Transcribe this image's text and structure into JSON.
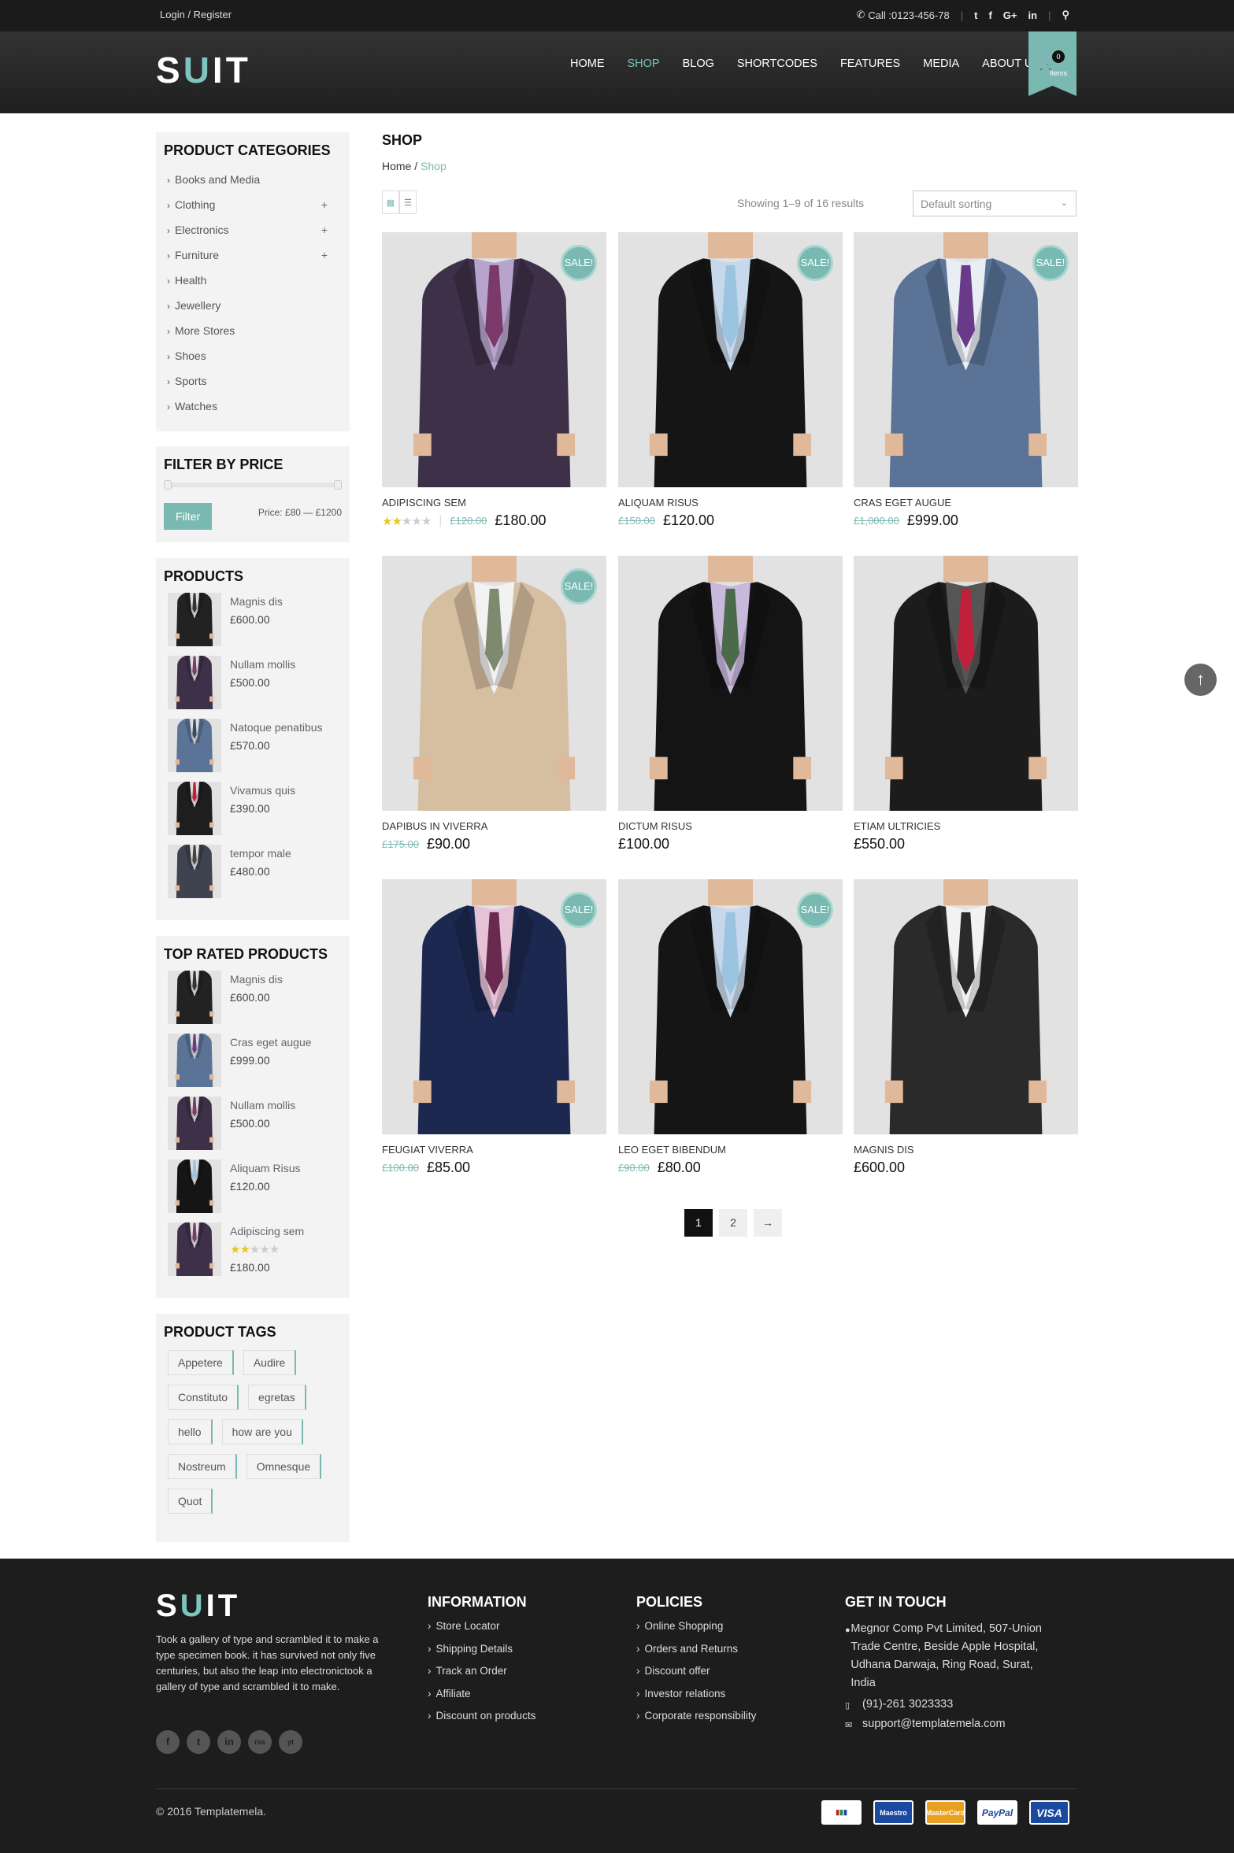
{
  "topbar": {
    "login": "Login / Register",
    "phone": "Call :0123-456-78",
    "social": [
      "twitter-icon",
      "facebook-icon",
      "google-plus-icon",
      "linkedin-icon"
    ],
    "social_labels": [
      "t",
      "f",
      "G+",
      "in"
    ]
  },
  "header": {
    "logo_s": "S",
    "logo_u": "U",
    "logo_it": "IT",
    "nav": [
      "HOME",
      "SHOP",
      "BLOG",
      "SHORTCODES",
      "FEATURES",
      "MEDIA",
      "ABOUT US"
    ],
    "active_nav": "SHOP",
    "cart_count": "0",
    "cart_label": "Items"
  },
  "categories": {
    "title": "PRODUCT CATEGORIES",
    "items": [
      {
        "label": "Books and Media",
        "expand": ""
      },
      {
        "label": "Clothing",
        "expand": "+"
      },
      {
        "label": "Electronics",
        "expand": "+"
      },
      {
        "label": "Furniture",
        "expand": "+"
      },
      {
        "label": "Health",
        "expand": ""
      },
      {
        "label": "Jewellery",
        "expand": ""
      },
      {
        "label": "More Stores",
        "expand": ""
      },
      {
        "label": "Shoes",
        "expand": ""
      },
      {
        "label": "Sports",
        "expand": ""
      },
      {
        "label": "Watches",
        "expand": ""
      }
    ]
  },
  "filter": {
    "title": "FILTER BY PRICE",
    "button": "Filter",
    "range_label": "Price: £80 — £1200"
  },
  "products_widget": {
    "title": "PRODUCTS",
    "items": [
      {
        "name": "Magnis dis",
        "price": "£600.00",
        "suit": "#222",
        "tie": "#333"
      },
      {
        "name": "Nullam mollis",
        "price": "£500.00",
        "suit": "#3d3048",
        "tie": "#7a3a6a"
      },
      {
        "name": "Natoque penatibus",
        "price": "£570.00",
        "suit": "#5a7396",
        "tie": "#3a4a6a"
      },
      {
        "name": "Vivamus quis",
        "price": "£390.00",
        "suit": "#1e1e1e",
        "tie": "#c0203a"
      },
      {
        "name": "tempor male",
        "price": "£480.00",
        "suit": "#3f4350",
        "tie": "#444"
      }
    ]
  },
  "top_rated": {
    "title": "TOP RATED PRODUCTS",
    "items": [
      {
        "name": "Magnis dis",
        "price": "£600.00",
        "suit": "#222",
        "tie": "#333",
        "stars": 0
      },
      {
        "name": "Cras eget augue",
        "price": "£999.00",
        "suit": "#5a7396",
        "tie": "#6a3a8a",
        "stars": 0
      },
      {
        "name": "Nullam mollis",
        "price": "£500.00",
        "suit": "#3d3048",
        "tie": "#7a3a6a",
        "stars": 0
      },
      {
        "name": "Aliquam Risus",
        "price": "£120.00",
        "suit": "#151515",
        "tie": "#9bc4e0",
        "stars": 0
      },
      {
        "name": "Adipiscing sem",
        "price": "£180.00",
        "suit": "#3d3048",
        "tie": "#7a3a6a",
        "stars": 2
      }
    ]
  },
  "tags": {
    "title": "PRODUCT TAGS",
    "items": [
      "Appetere",
      "Audire",
      "Constituto",
      "egretas",
      "hello",
      "how are you",
      "Nostreum",
      "Omnesque",
      "Quot"
    ]
  },
  "shop": {
    "title": "SHOP",
    "crumb_home": "Home",
    "crumb_sep": "/",
    "crumb_current": "Shop",
    "results": "Showing 1–9 of 16 results",
    "sort": "Default sorting"
  },
  "products": [
    {
      "name": "ADIPISCING SEM",
      "old": "£120.00",
      "price": "£180.00",
      "sale": true,
      "stars": 2,
      "suit": "#3d3048",
      "tie": "#7a3a6a",
      "shirt": "#b7a4cc",
      "pants": "#3d3048"
    },
    {
      "name": "ALIQUAM RISUS",
      "old": "£150.00",
      "price": "£120.00",
      "sale": true,
      "stars": 0,
      "suit": "#151515",
      "tie": "#9bc4e0",
      "shirt": "#c8d8ec",
      "pants": "#151515"
    },
    {
      "name": "CRAS EGET AUGUE",
      "old": "£1,000.00",
      "price": "£999.00",
      "sale": true,
      "stars": 0,
      "suit": "#5a7396",
      "tie": "#6a3a8a",
      "shirt": "#e9eef4",
      "pants": "#5a7396"
    },
    {
      "name": "DAPIBUS IN VIVERRA",
      "old": "£175.00",
      "price": "£90.00",
      "sale": true,
      "stars": 0,
      "suit": "#d6bfa0",
      "tie": "#7d8a6e",
      "shirt": "#f2f2f2",
      "pants": "#d6bfa0"
    },
    {
      "name": "DICTUM RISUS",
      "old": "",
      "price": "£100.00",
      "sale": false,
      "stars": 0,
      "suit": "#141414",
      "tie": "#4a6a4a",
      "shirt": "#c7b8dc",
      "pants": "#141414"
    },
    {
      "name": "ETIAM ULTRICIES",
      "old": "",
      "price": "£550.00",
      "sale": false,
      "stars": 0,
      "suit": "#1c1c1c",
      "tie": "#c0203a",
      "shirt": "#555",
      "pants": "#1c1c1c"
    },
    {
      "name": "FEUGIAT VIVERRA",
      "old": "£100.00",
      "price": "£85.00",
      "sale": true,
      "stars": 0,
      "suit": "#1d2850",
      "tie": "#6a2a50",
      "shirt": "#e6c2d6",
      "pants": "#1d2850"
    },
    {
      "name": "LEO EGET BIBENDUM",
      "old": "£90.00",
      "price": "£80.00",
      "sale": true,
      "stars": 0,
      "suit": "#151515",
      "tie": "#9bc4e0",
      "shirt": "#c8d8ec",
      "pants": "#151515"
    },
    {
      "name": "MAGNIS DIS",
      "old": "",
      "price": "£600.00",
      "sale": false,
      "stars": 0,
      "suit": "#2a2a2a",
      "tie": "#2a2a2a",
      "shirt": "#f2f2f2",
      "pants": "#2a2a2a"
    }
  ],
  "sale_label": "SALE!",
  "pagination": [
    "1",
    "2",
    "→"
  ],
  "footer": {
    "logo_s": "S",
    "logo_u": "U",
    "logo_it": "IT",
    "desc": "Took a gallery of type and scrambled it to make a type specimen book. it has survived not only five centuries, but also the leap into electronictook a gallery of type and scrambled it to make.",
    "social": [
      "f",
      "t",
      "in",
      "rss",
      "yt"
    ],
    "information": {
      "title": "INFORMATION",
      "items": [
        "Store Locator",
        "Shipping Details",
        "Track an Order",
        "Affiliate",
        "Discount on products"
      ]
    },
    "policies": {
      "title": "POLICIES",
      "items": [
        "Online Shopping",
        "Orders and Returns",
        "Discount offer",
        "Investor relations",
        "Corporate responsibility"
      ]
    },
    "contact": {
      "title": "GET IN TOUCH",
      "address": "Megnor Comp Pvt Limited, 507-Union Trade Centre, Beside Apple Hospital, Udhana Darwaja, Ring Road, Surat, India",
      "phone": "(91)-261 3023333",
      "email": "support@templatemela.com"
    },
    "copyright": "© 2016 Templatemela.",
    "payments": [
      "Maestro",
      "MasterCard",
      "PayPal",
      "VISA"
    ]
  },
  "colors": {
    "accent": "#7ab9b1",
    "dark": "#1b1b1b"
  }
}
